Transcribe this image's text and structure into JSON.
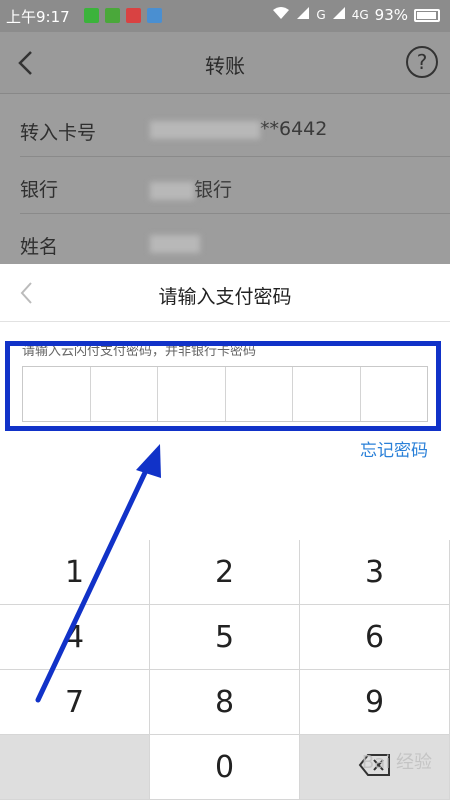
{
  "status_bar": {
    "time": "上午9:17",
    "network": "G",
    "network2": "4G",
    "battery": "93%"
  },
  "nav": {
    "title": "转账",
    "back_icon": "chevron-left-icon",
    "help_icon": "question-circle-icon"
  },
  "transfer": {
    "rows": [
      {
        "label": "转入卡号",
        "value": "**6442"
      },
      {
        "label": "银行",
        "value": "银行"
      },
      {
        "label": "姓名",
        "value": ""
      }
    ]
  },
  "password_sheet": {
    "title": "请输入支付密码",
    "hint": "请输入云闪付支付密码，并非银行卡密码",
    "forgot_label": "忘记密码"
  },
  "keypad": {
    "keys": [
      "1",
      "2",
      "3",
      "4",
      "5",
      "6",
      "7",
      "8",
      "9",
      "",
      "0",
      "⌫"
    ]
  },
  "watermark": "Bai 经验",
  "colors": {
    "highlight": "#1132c8",
    "link": "#2a80d8"
  }
}
